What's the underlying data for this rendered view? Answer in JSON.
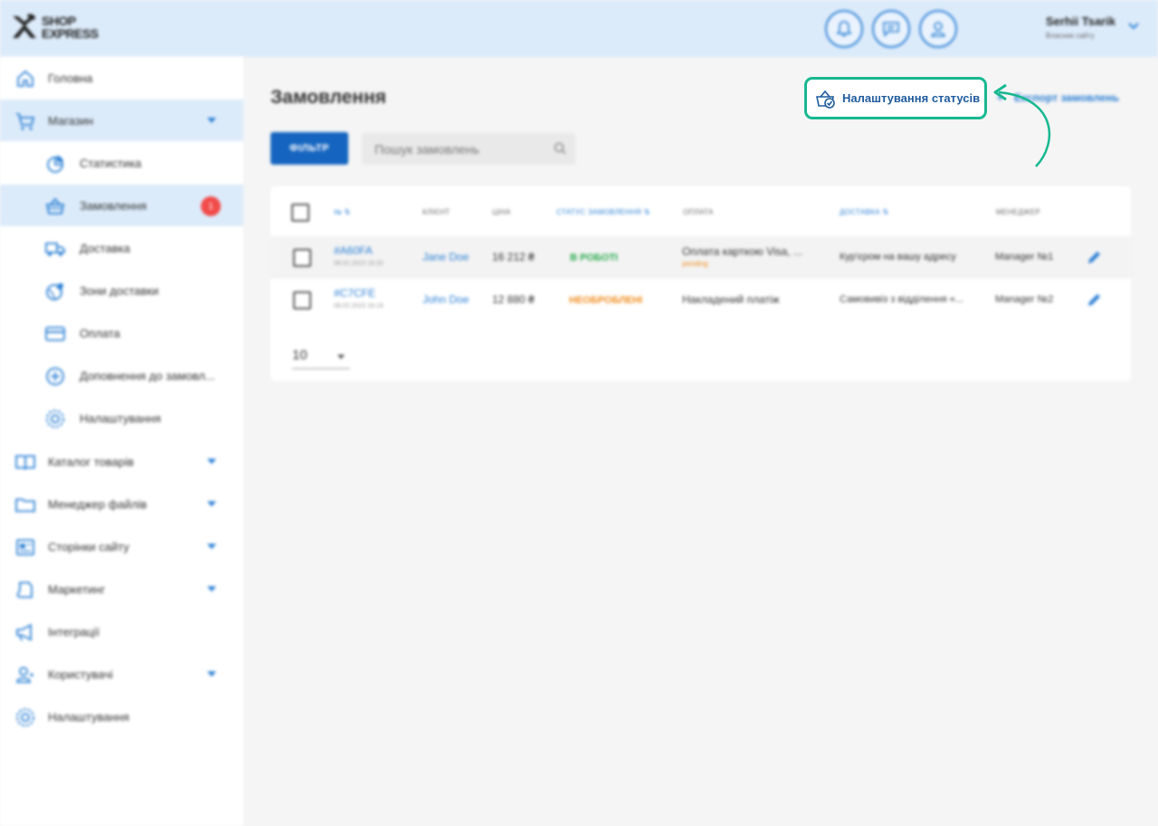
{
  "header": {
    "logo_line1": "SHOP",
    "logo_line2": "EXPRESS",
    "user_name": "Serhii Tsarik",
    "user_role": "Власник сайту"
  },
  "sidebar": {
    "items": [
      {
        "label": "Головна",
        "icon": "home-icon"
      },
      {
        "label": "Магазин",
        "icon": "cart-icon"
      },
      {
        "label": "Статистика",
        "icon": "pie-chart-icon"
      },
      {
        "label": "Замовлення",
        "icon": "basket-icon",
        "badge": "1"
      },
      {
        "label": "Доставка",
        "icon": "truck-icon"
      },
      {
        "label": "Зони доставки",
        "icon": "globe-icon"
      },
      {
        "label": "Оплата",
        "icon": "credit-card-icon"
      },
      {
        "label": "Доповнення до замовл...",
        "icon": "plus-circle-icon"
      },
      {
        "label": "Налаштування",
        "icon": "gear-icon"
      },
      {
        "label": "Каталог товарів",
        "icon": "book-icon"
      },
      {
        "label": "Менеджер файлів",
        "icon": "folder-icon"
      },
      {
        "label": "Сторінки сайту",
        "icon": "page-icon"
      },
      {
        "label": "Маркетинг",
        "icon": "tag-icon"
      },
      {
        "label": "Інтеграції",
        "icon": "megaphone-icon"
      },
      {
        "label": "Користувачі",
        "icon": "users-icon"
      },
      {
        "label": "Налаштування",
        "icon": "gear-icon"
      }
    ]
  },
  "main": {
    "title": "Замовлення",
    "filter_label": "ФІЛЬТР",
    "search_placeholder": "Пошук замовлень",
    "status_settings_label": "Налаштування статусів",
    "export_label": "Експорт замовлень",
    "columns": [
      "№",
      "КЛІЄНТ",
      "ЦІНА",
      "СТАТУС ЗАМОВЛЕННЯ",
      "ОПЛАТА",
      "ДОСТАВКА",
      "МЕНЕДЖЕР"
    ],
    "rows": [
      {
        "id": "#A60FA",
        "date": "08.02.2023 16:20",
        "client": "Jane Doe",
        "price": "16 212 ₴",
        "status": "В РОБОТІ",
        "payment": "Оплата карткою Visa, ...",
        "payment_state": "pending",
        "delivery": "Кур'єром на вашу адресу",
        "manager": "Manager №1"
      },
      {
        "id": "#C7CFE",
        "date": "08.02.2023 16:19",
        "client": "John Doe",
        "price": "12 880 ₴",
        "status": "НЕОБРОБЛЕНІ",
        "payment": "Накладений платіж",
        "payment_state": "",
        "delivery": "Самовивіз з відділення «...",
        "manager": "Manager №2"
      }
    ],
    "per_page": "10"
  },
  "colors": {
    "accent": "#2a7fd4",
    "highlight_outline": "#17b890",
    "status_in_work": "#27a84a",
    "status_new": "#f08c1e"
  }
}
